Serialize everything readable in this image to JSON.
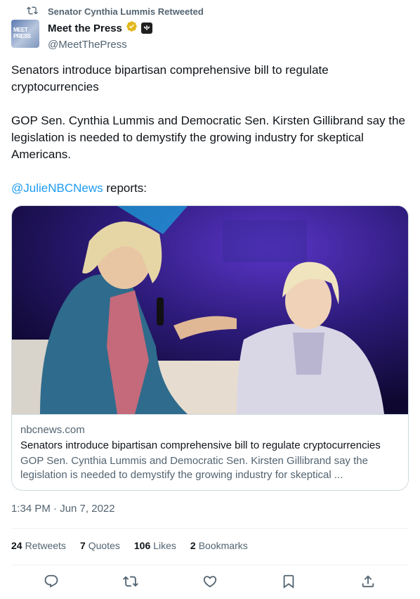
{
  "retweet": {
    "text": "Senator Cynthia Lummis Retweeted",
    "icon": "retweet-icon"
  },
  "author": {
    "name": "Meet the Press",
    "handle": "@MeetThePress",
    "avatar_text": "MEET PRESS",
    "verified_icon": "gold-verified-badge-icon",
    "affiliate_icon": "nbc-peacock-icon"
  },
  "tweet": {
    "paragraphs": [
      "Senators introduce bipartisan comprehensive bill to regulate cryptocurrencies",
      "GOP Sen. Cynthia Lummis and Democratic Sen. Kirsten Gillibrand say the legislation is needed to demystify the growing industry for skeptical Americans."
    ],
    "mention": "@JulieNBCNews",
    "mention_suffix": " reports:"
  },
  "card": {
    "domain": "nbcnews.com",
    "title": "Senators introduce bipartisan comprehensive bill to regulate cryptocurrencies",
    "description": "GOP Sen. Cynthia Lummis and Democratic Sen. Kirsten Gillibrand say the legislation is needed to demystify the growing industry for skeptical ..."
  },
  "timestamp": "1:34 PM · Jun 7, 2022",
  "stats": {
    "retweets": {
      "count": "24",
      "label": "Retweets"
    },
    "quotes": {
      "count": "7",
      "label": "Quotes"
    },
    "likes": {
      "count": "106",
      "label": "Likes"
    },
    "bookmarks": {
      "count": "2",
      "label": "Bookmarks"
    }
  },
  "actions": [
    "reply-icon",
    "retweet-icon",
    "like-icon",
    "bookmark-icon",
    "share-icon"
  ],
  "colors": {
    "link": "#1d9bf0",
    "secondary_text": "#536471",
    "primary_text": "#0f1419",
    "border": "#cfd9de",
    "verified_gold": "#e2b719"
  }
}
